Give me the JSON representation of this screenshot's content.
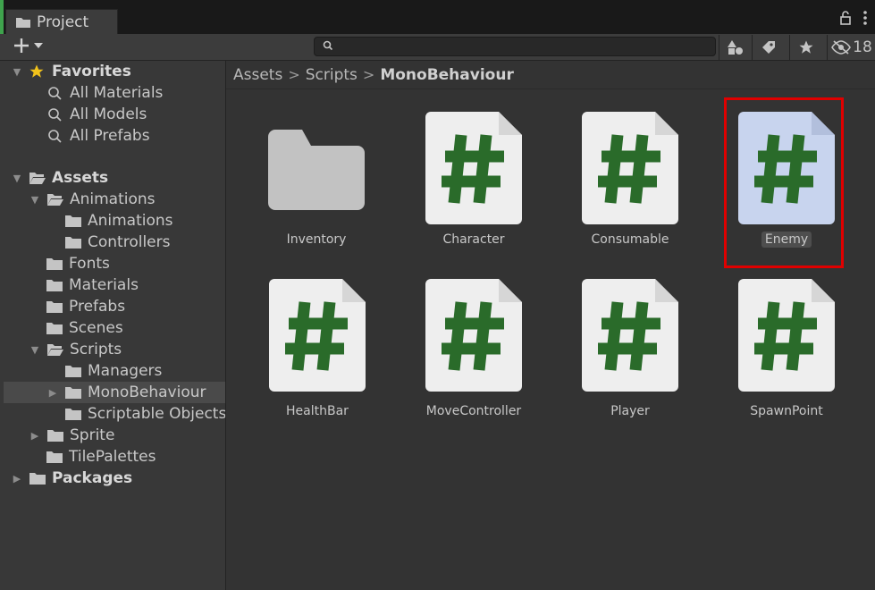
{
  "window": {
    "tab_title": "Project",
    "hidden_count": "18"
  },
  "toolbar": {
    "search_placeholder": "",
    "buttons": [
      "create-menu",
      "search-by-type",
      "search-by-label",
      "favorites",
      "hidden-packages"
    ]
  },
  "sidebar": {
    "favorites": {
      "label": "Favorites",
      "items": [
        "All Materials",
        "All Models",
        "All Prefabs"
      ]
    },
    "assets": {
      "label": "Assets",
      "animations": "Animations",
      "animations_children": [
        "Animations",
        "Controllers"
      ],
      "fonts": "Fonts",
      "materials": "Materials",
      "prefabs": "Prefabs",
      "scenes": "Scenes",
      "scripts": "Scripts",
      "scripts_children": [
        "Managers",
        "MonoBehaviour",
        "Scriptable Objects"
      ],
      "sprite": "Sprite",
      "tilepalettes": "TilePalettes"
    },
    "packages": "Packages",
    "selected": "MonoBehaviour"
  },
  "breadcrumb": [
    "Assets",
    "Scripts",
    "MonoBehaviour"
  ],
  "assets": [
    {
      "name": "Inventory",
      "type": "folder"
    },
    {
      "name": "Character",
      "type": "script"
    },
    {
      "name": "Consumable",
      "type": "script"
    },
    {
      "name": "Enemy",
      "type": "script",
      "selected": true
    },
    {
      "name": "HealthBar",
      "type": "script"
    },
    {
      "name": "MoveController",
      "type": "script"
    },
    {
      "name": "Player",
      "type": "script"
    },
    {
      "name": "SpawnPoint",
      "type": "script"
    }
  ],
  "colors": {
    "script_hash": "#2a6b2a",
    "script_page": "#eeeeee",
    "script_page_selected": "#c8d4ee",
    "folder": "#c2c2c2",
    "highlight": "#e00000",
    "favorites_star": "#f1c21b"
  }
}
